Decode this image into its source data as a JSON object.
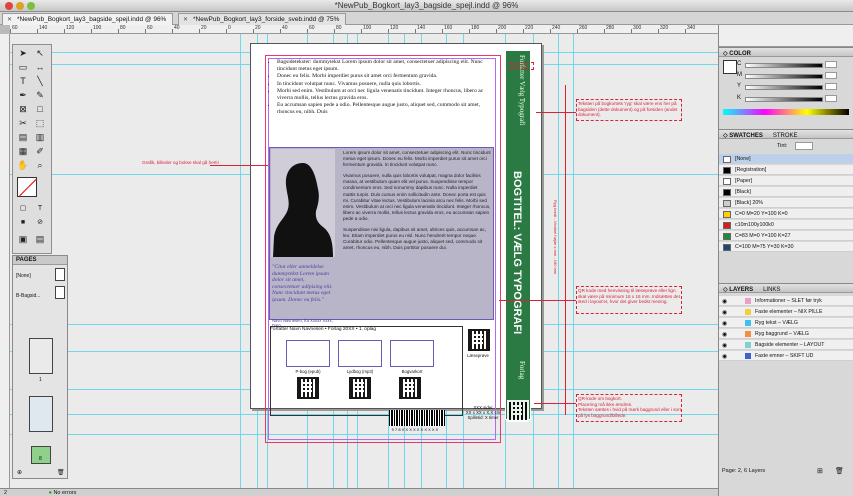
{
  "window": {
    "title": "*NewPub_Bogkort_lay3_bagside_spejl.indd @ 96%"
  },
  "tabs": [
    {
      "label": "*NewPub_Bogkort_lay3_bagside_spejl.indd @ 96%"
    },
    {
      "label": "*NewPub_Bogkort_lay3_forside_sveb.indd @ 75%"
    }
  ],
  "ruler": {
    "labels": [
      "60",
      "140",
      "120",
      "100",
      "80",
      "60",
      "40",
      "20",
      "0",
      "20",
      "40",
      "60",
      "80",
      "100",
      "120",
      "140",
      "160",
      "180",
      "200",
      "220",
      "240",
      "260",
      "280",
      "300",
      "320",
      "340"
    ]
  },
  "pages_panel": {
    "title": "PAGES",
    "master_none": "[None]",
    "master_b": "B-Bagsid...",
    "page_numbers": [
      "1",
      "8"
    ]
  },
  "page": {
    "bullets": [
      "Bagsidetekster: dummytekst Lorem ipsum dolor sit amet, consectetuer adipiscing elit. Nunc tincidunt metus eget ipsum.",
      "Donec eu felis. Morbi imperdiet purus sit amet orci fermentum gravida.",
      "In tincidunt volutpat nunc. Vivamus posuere, nulla quis lobortis.",
      "Morbi sed enim. Vestibulum at orci nec ligula venenatis tincidunt. Integer rhoncus, libero ac viverra mollis, tellus lectus gravida eros.",
      "Eu accumsan sapien pede a odio. Pellentesque augue justo, aliquet sed, commodo sit amet, rhoncus eu, nibh. Duis"
    ],
    "quote": "\"Citat eller anmeldelse dummytekst Lorem ipsum dolor sit amet, consectetuer adipis­ing elit. Nunc tincidunt metus eget ipsum. Donec eu felis.\"",
    "quote_author": "Navn Navnesen,\nfra Xxxxx Xxxx, Dato",
    "body": [
      "Lorem ipsum dolor sit amet, consectetuer adipiscing elit. Nunc tincidunt metus eget ipsum. Donec eu felis. Morbi imperdiet purus sit amet orci fermentum gravida. In tincidunt volutpat nunc.",
      "Vivamus posuere, nulla quis lobortis volutpat, magna dolor facilisis massa, at vestibulum quam elit vel purus. Suspendisse tempor condimentum eros. Sed nonummy dapibus nunc. Nulla imperdiet mattis turpis. Duis cursus enim sollicitudin ante. Donec porta est quis mi. Curabitur vitae lectus. Vestibulum lacinia arcu nec felis. Morbi sed enim. Vestibulum at orci nec ligula venenatis tincidunt. Integer rhoncus, libero ac viverra mollis, tellus lectus gravida eros, eu accumsan sapien pede a odio.",
      "Suspendisse nisi ligula, dapibus sit amet, ultrices quis, accumsan ac, leo. Etiam imperdiet purus eu nisl. Nunc hendrerit tempor neque. Curabitur odio. Pellentesque augue justo, aliquet sed, commodo sit amet, rhoncus eu, nibh. Duis porttitor posuere dui."
    ],
    "footer_head": "Forfatter Navn Navnesen  •  Forlag 20XX  •  1. oplag",
    "labels": [
      "P-bog (epub)",
      "Lydbog (mp3)",
      "Bogvarkort"
    ],
    "laeseprove": "Læseprøve",
    "xxx": "XXX sider\nXX x XX x X,X cm\nSpilletid: X timer",
    "isbn": "9 7 8 X X X X X X X X X X"
  },
  "spine": {
    "title": "BOGTITEL: VÆLG TYPOGRAFI",
    "author": "Forfatter Vælg Typografi",
    "publisher": "Forlag"
  },
  "notes": {
    "bog_ryg": "Bog ryg",
    "left": "Grafik, billeder og bokse skal gå herti!",
    "right1": "Teksten på bogkortets 'ryg' skal være ens her på bagsiden (dette dokument) og på forsiden (andet dokument).",
    "size": "Ryg bredt - Ventriel højde x mm - 180 mm",
    "right2": "QR kode med henvisning til læseprøve eller lign. skal være på minimum 16 x 16 mm. Indsættes det sted i layout'et, hvor det giver bedst mening.",
    "right3": "QR-kode om bogkort.\nPlacering må ikke ændres.\nTeksten sættes i hvid på mørk baggrund eller i sort på lys baggrund/billede."
  },
  "color_panel": {
    "title": "COLOR",
    "channels": [
      "C",
      "M",
      "Y",
      "K"
    ]
  },
  "swatches_panel": {
    "title": "SWATCHES",
    "tab2": "STROKE",
    "tint_label": "Tint:",
    "tint_value": "",
    "items": [
      {
        "name": "[None]",
        "color": "#ffffff"
      },
      {
        "name": "[Registration]",
        "color": "#000000"
      },
      {
        "name": "[Paper]",
        "color": "#ffffff"
      },
      {
        "name": "[Black]",
        "color": "#000000"
      },
      {
        "name": "[Black] 20%",
        "color": "#cccccc"
      },
      {
        "name": "C=0 M=20 Y=100 K=0",
        "color": "#fdd000"
      },
      {
        "name": "c10m100y100k0",
        "color": "#d81c22"
      },
      {
        "name": "C=83 M=0 Y=100 K=27",
        "color": "#1e8a3c"
      },
      {
        "name": "C=100 M=75 Y=30 K=30",
        "color": "#1c4a73"
      }
    ]
  },
  "layers_panel": {
    "title": "LAYERS",
    "tab2": "LINKS",
    "items": [
      {
        "name": "Informationer – SLET før tryk",
        "color": "#e8a0c8"
      },
      {
        "name": "Faste elementer – NIX PILLE",
        "color": "#f0d040"
      },
      {
        "name": "Ryg tekst – VÆLG",
        "color": "#40c0f0"
      },
      {
        "name": "Ryg baggrund – VÆLG",
        "color": "#f09040"
      },
      {
        "name": "Bagside elementer – LAYOUT",
        "color": "#80d0d0"
      },
      {
        "name": "Faste emner – SKIFT UD",
        "color": "#4060d0"
      }
    ],
    "footer": "Page: 2, 6 Layers"
  },
  "statusbar": {
    "page": "2",
    "status": "No errors"
  }
}
